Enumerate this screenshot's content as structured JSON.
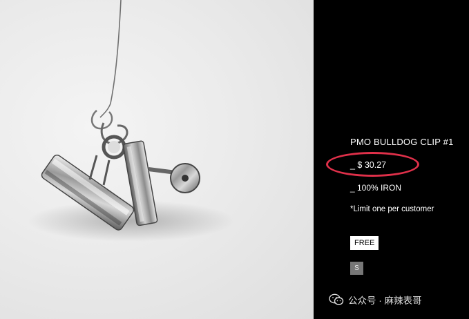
{
  "product": {
    "image_alt": "bulldog-clip-photo",
    "title": "PMO BULLDOG CLIP #1",
    "price": "_ $ 30.27",
    "material": "_ 100% IRON",
    "limit_note": "*Limit one per customer",
    "free_label": "FREE",
    "size_label": "S"
  },
  "watermark": {
    "text": "公众号 · 麻辣表哥",
    "icon": "wechat-icon"
  },
  "colors": {
    "panel_bg": "#000000",
    "highlight_ring": "#e0304a",
    "size_swatch": "#777777"
  }
}
